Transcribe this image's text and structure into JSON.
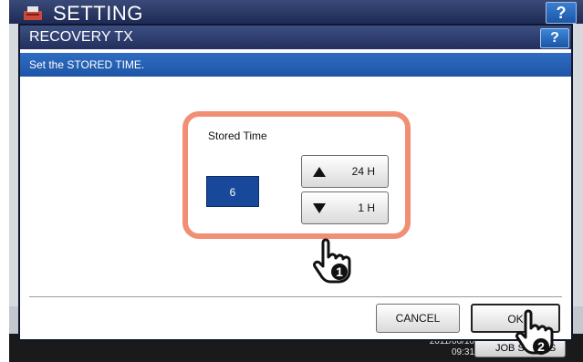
{
  "background_screen": {
    "title": "SETTING",
    "help_label": "?",
    "clock_line1": "2011/06/10",
    "clock_line2": "09:31",
    "job_status_label": "JOB STATUS"
  },
  "dialog": {
    "title": "RECOVERY TX",
    "help_label": "?",
    "message": "Set the STORED TIME."
  },
  "stored_time": {
    "label": "Stored Time",
    "value": "6",
    "increase_label": "24 H",
    "decrease_label": "1 H"
  },
  "footer": {
    "cancel_label": "CANCEL",
    "ok_label": "OK"
  },
  "callouts": {
    "step1": "1",
    "step2": "2"
  },
  "colors": {
    "highlight": "#f08f74",
    "header": "#2b3a6b",
    "message_bar": "#2a63b5",
    "value_box": "#17489a"
  },
  "icons": [
    "printer-logo-icon",
    "arrow-up-icon",
    "arrow-down-icon",
    "hand-pointer-icon"
  ]
}
